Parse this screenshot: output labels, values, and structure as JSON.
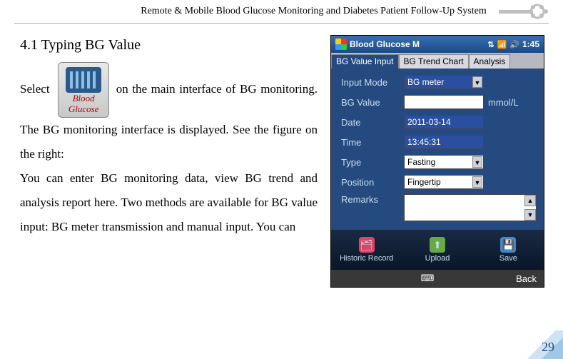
{
  "header": {
    "title": "Remote & Mobile Blood Glucose Monitoring and Diabetes Patient Follow-Up System"
  },
  "page_number": "29",
  "section": {
    "heading": "4.1 Typing BG Value",
    "icon_label_line1": "Blood",
    "icon_label_line2": "Glucose",
    "para_before_icon": "Select",
    "para_after_icon": " on the main interface of BG monitoring. The BG monitoring interface is displayed. See the figure on the right:",
    "para2": "You can enter BG monitoring data, view BG trend and analysis report here. Two methods are available for BG value input: BG meter transmission and manual input. You can"
  },
  "screenshot": {
    "window_title": "Blood Glucose M",
    "clock": "1:45",
    "tabs": [
      "BG Value Input",
      "BG Trend Chart",
      "Analysis"
    ],
    "active_tab_index": 0,
    "fields": {
      "input_mode": {
        "label": "Input Mode",
        "value": "BG meter"
      },
      "bg_value": {
        "label": "BG Value",
        "value": "",
        "unit": "mmol/L"
      },
      "date": {
        "label": "Date",
        "value": "2011-03-14"
      },
      "time": {
        "label": "Time",
        "value": "13:45:31"
      },
      "type": {
        "label": "Type",
        "value": "Fasting"
      },
      "position": {
        "label": "Position",
        "value": "Fingertip"
      },
      "remarks": {
        "label": "Remarks",
        "value": ""
      }
    },
    "bottom_bar": {
      "items": [
        "Historic Record",
        "Upload",
        "Save"
      ]
    },
    "soft_bar": {
      "left": "",
      "right": "Back"
    }
  }
}
